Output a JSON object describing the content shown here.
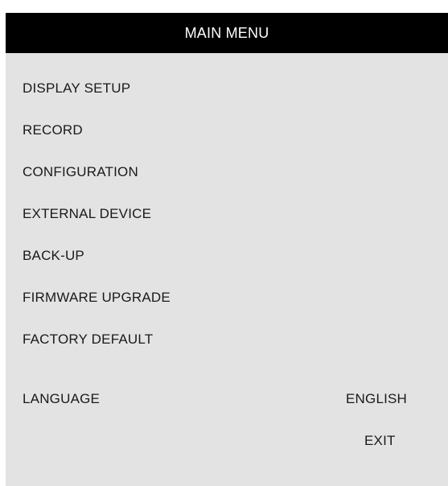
{
  "header": {
    "title": "MAIN MENU"
  },
  "menu": {
    "items": [
      {
        "label": "DISPLAY SETUP"
      },
      {
        "label": "RECORD"
      },
      {
        "label": "CONFIGURATION"
      },
      {
        "label": "EXTERNAL DEVICE"
      },
      {
        "label": "BACK-UP"
      },
      {
        "label": "FIRMWARE UPGRADE"
      },
      {
        "label": "FACTORY DEFAULT"
      }
    ],
    "language_label": "LANGUAGE",
    "language_value": "ENGLISH",
    "exit_label": "EXIT"
  },
  "colors": {
    "header_bg": "#000000",
    "header_text": "#ffffff",
    "panel_bg": "#e3e3e3",
    "text": "#1a1a1a"
  }
}
